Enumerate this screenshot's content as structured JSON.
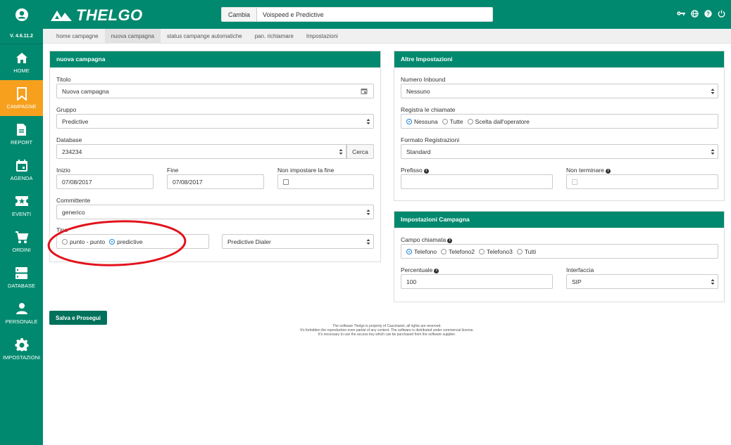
{
  "app": {
    "version": "V. 4.6.11.2",
    "brand_name": "THELGO",
    "brand_color": "#00896e",
    "accent_color": "#f7a01d"
  },
  "sidebar": {
    "items": [
      {
        "label": "HOME",
        "icon": "home-icon"
      },
      {
        "label": "CAMPAGNE",
        "icon": "bookmark-icon",
        "active": true
      },
      {
        "label": "REPORT",
        "icon": "document-icon"
      },
      {
        "label": "AGENDA",
        "icon": "calendar-icon"
      },
      {
        "label": "EVENTI",
        "icon": "ticket-icon"
      },
      {
        "label": "ORDINI",
        "icon": "cart-icon"
      },
      {
        "label": "DATABASE",
        "icon": "database-icon"
      },
      {
        "label": "PERSONALE",
        "icon": "person-icon"
      },
      {
        "label": "IMPOSTAZIONI",
        "icon": "gear-icon"
      }
    ]
  },
  "topbar": {
    "search_button": "Cambia",
    "search_value": "Voispeed e Predictive",
    "icons": [
      "key-icon",
      "globe-icon",
      "help-icon",
      "power-icon"
    ]
  },
  "tabs": [
    {
      "label": "home campagne"
    },
    {
      "label": "nuova campagna",
      "active": true
    },
    {
      "label": "status campange automatiche"
    },
    {
      "label": "pan. richiamare"
    },
    {
      "label": "Impostazioni"
    }
  ],
  "nuova": {
    "title": "nuova campagna",
    "titolo_label": "Titolo",
    "titolo_value": "Nuova campagna",
    "gruppo_label": "Gruppo",
    "gruppo_value": "Predictive",
    "database_label": "Database",
    "database_value": "234234",
    "cerca_label": "Cerca",
    "inizio_label": "Inizio",
    "inizio_value": "07/08/2017",
    "fine_label": "Fine",
    "fine_value": "07/08/2017",
    "non_fine_label": "Non impostare la fine",
    "committente_label": "Committente",
    "committente_value": "generico",
    "tipo_label": "Tipo",
    "tipo_options": [
      "punto - punto",
      "predictive"
    ],
    "tipo_selected": "predictive",
    "dialer_value": "Predictive Dialer"
  },
  "altre": {
    "title": "Altre Impostazioni",
    "inbound_label": "Numero Inbound",
    "inbound_value": "Nessuno",
    "registra_label": "Registra le chiamate",
    "registra_options": [
      "Nessuna",
      "Tutte",
      "Scelta dall'operatore"
    ],
    "registra_selected": "Nessuna",
    "formato_label": "Formato Registrazioni",
    "formato_value": "Standard",
    "prefisso_label": "Prefisso",
    "non_terminare_label": "Non terminare"
  },
  "imp_campagna": {
    "title": "Impostazioni Campagna",
    "campo_label": "Campo chiamata",
    "campo_options": [
      "Telefono",
      "Telefono2",
      "Telefono3",
      "Tutti"
    ],
    "campo_selected": "Telefono",
    "percentuale_label": "Percentuale",
    "percentuale_value": "100",
    "interfaccia_label": "Interfaccia",
    "interfaccia_value": "SIP"
  },
  "actions": {
    "save_label": "Salva e Prosegui"
  },
  "footer": {
    "line1": "The software Thelgo is property of Cascinanet, all rights are reserved.",
    "line2": "It's forbidden the reproduction even partial of any content. The software is distributed under commercial license.",
    "line3": "It's necessary to use the access key which can be purchased from the software supplier."
  }
}
